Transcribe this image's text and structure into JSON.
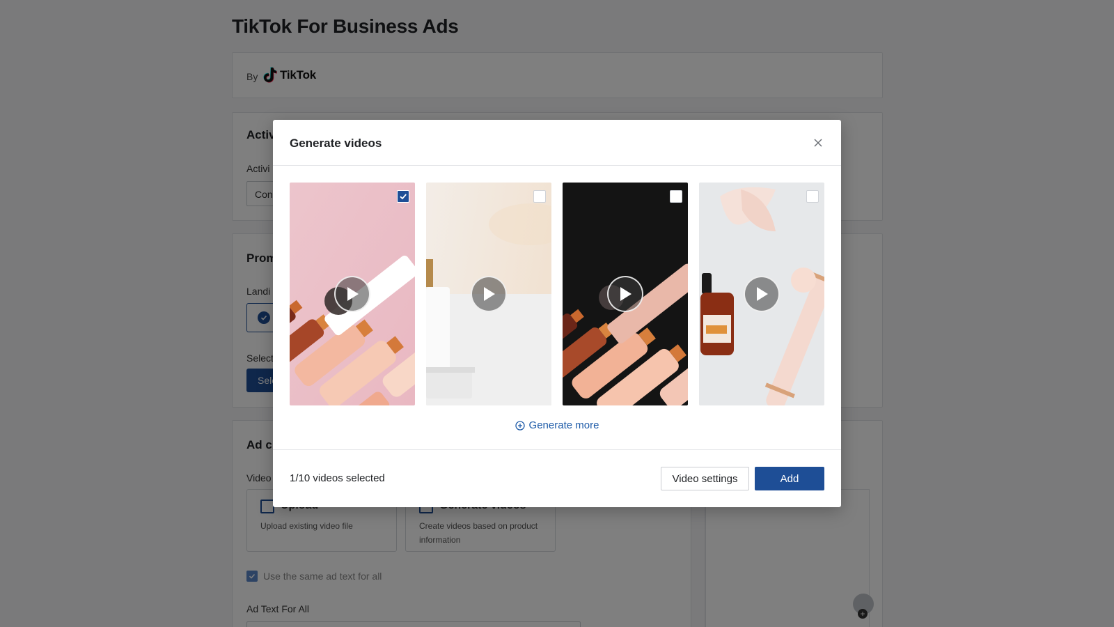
{
  "page": {
    "title": "TikTok For Business Ads",
    "by_label": "By",
    "brand_name": "TikTok",
    "activity": {
      "title": "Activi",
      "field_label": "Activi",
      "input_value": "Con"
    },
    "promotion": {
      "title": "Prom",
      "landing_label": "Landi",
      "select_label": "Select",
      "select_button": "Sele"
    },
    "ad_creative": {
      "title": "Ad cr",
      "video_label": "Video",
      "upload_title": "Upload",
      "upload_sub": "Upload existing video file",
      "generate_title": "Generate videos",
      "generate_sub": "Create videos based on product information",
      "same_text_label": "Use the same ad text for all",
      "adtext_label": "Ad Text For All"
    }
  },
  "modal": {
    "title": "Generate videos",
    "close_icon": "close-icon",
    "videos": [
      {
        "checked": true,
        "theme": "pink-cosmetics"
      },
      {
        "checked": false,
        "theme": "white-serum"
      },
      {
        "checked": false,
        "theme": "dark-cosmetics"
      },
      {
        "checked": false,
        "theme": "rose-quartz-roller"
      }
    ],
    "generate_more": "Generate more",
    "selected_count": "1/10 videos selected",
    "video_settings_button": "Video settings",
    "add_button": "Add"
  },
  "colors": {
    "primary": "#1e4e96",
    "link": "#1e5ba8",
    "overlay": "rgba(0,0,0,0.5)"
  }
}
